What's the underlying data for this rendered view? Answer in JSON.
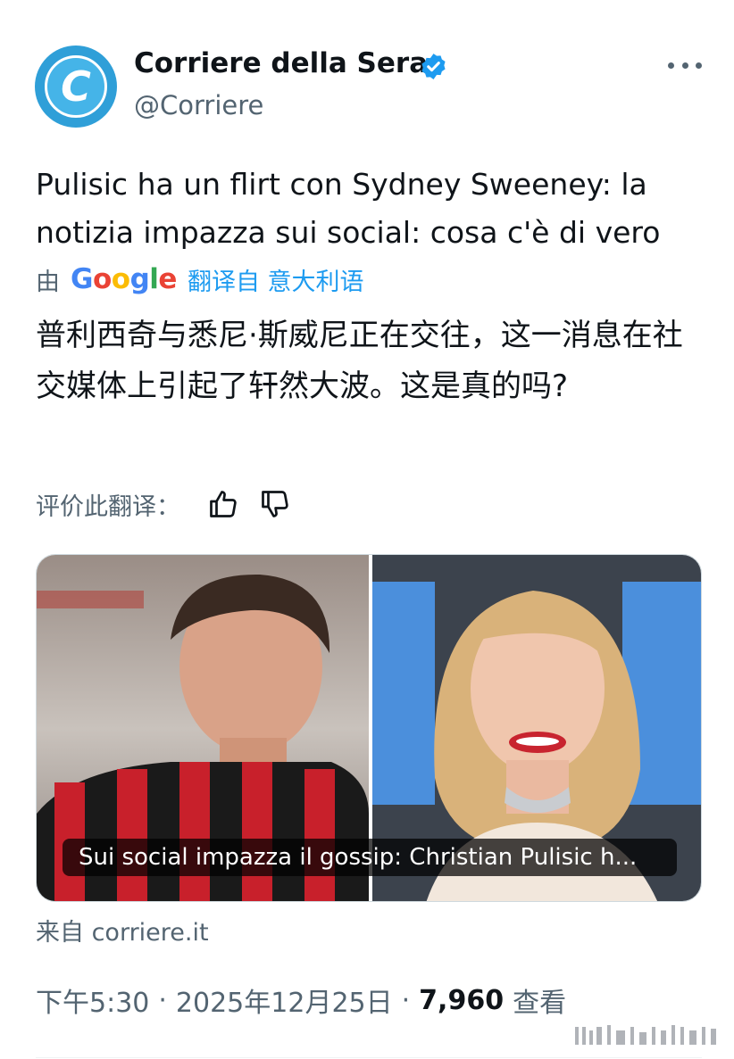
{
  "account": {
    "display_name": "Corriere della Sera",
    "handle": "@Corriere",
    "avatar_letter": "C",
    "brand_color": "#2f9fd8",
    "verified": true
  },
  "tweet": {
    "text": "Pulisic ha un flirt con Sydney Sweeney: la notizia impazza sui social: cosa c'è di vero"
  },
  "translation": {
    "prefix": "由",
    "provider": "Google",
    "label": "翻译自 意大利语",
    "text": "普利西奇与悉尼·斯威尼正在交往，这一消息在社交媒体上引起了轩然大波。这是真的吗?",
    "rate_label": "评价此翻译：",
    "rate_up_icon": "thumbs-up-icon",
    "rate_down_icon": "thumbs-down-icon"
  },
  "card": {
    "caption": "Sui social impazza il gossip: Christian Pulisic h...",
    "source": "来自 corriere.it"
  },
  "meta": {
    "time": "下午5:30",
    "date": "2025年12月25日",
    "separator": "·",
    "views_count": "7,960",
    "views_label": "查看"
  },
  "colors": {
    "text": "#0f1419",
    "secondary": "#536471",
    "link": "#1d9bf0"
  }
}
